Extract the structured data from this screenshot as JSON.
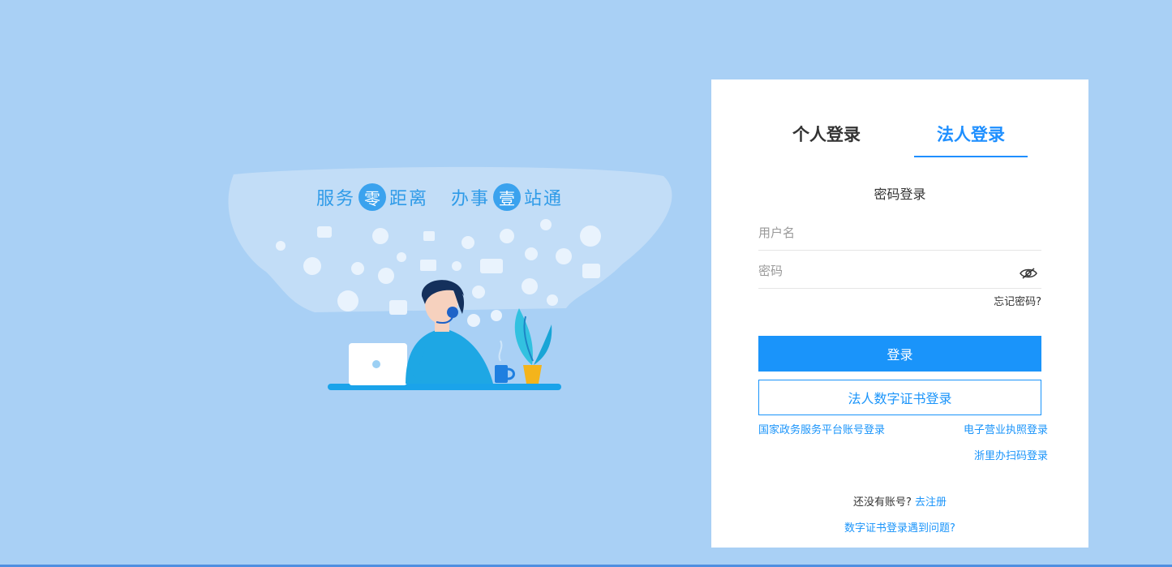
{
  "slogan": {
    "part1_pre": "服务",
    "part1_circle": "零",
    "part1_post": "距离",
    "part2_pre": "办事",
    "part2_circle": "壹",
    "part2_post": "站通"
  },
  "tabs": {
    "personal": "个人登录",
    "legal": "法人登录",
    "active": "legal"
  },
  "login": {
    "title": "密码登录",
    "username_placeholder": "用户名",
    "password_placeholder": "密码",
    "forgot": "忘记密码?",
    "submit": "登录",
    "cert_login": "法人数字证书登录"
  },
  "links": {
    "gov_account": "国家政务服务平台账号登录",
    "license_login": "电子营业执照登录",
    "zlb_scan": "浙里办扫码登录"
  },
  "register": {
    "prompt": "还没有账号?",
    "link": "去注册"
  },
  "cert_help": "数字证书登录遇到问题?",
  "colors": {
    "background": "#a9d0f5",
    "accent": "#1a94fa",
    "panel": "#ffffff"
  },
  "icons": [
    "eye-hidden-icon",
    "chat-bubble-icon",
    "phone-icon",
    "user-icon",
    "mail-icon",
    "question-icon",
    "heart-icon"
  ]
}
